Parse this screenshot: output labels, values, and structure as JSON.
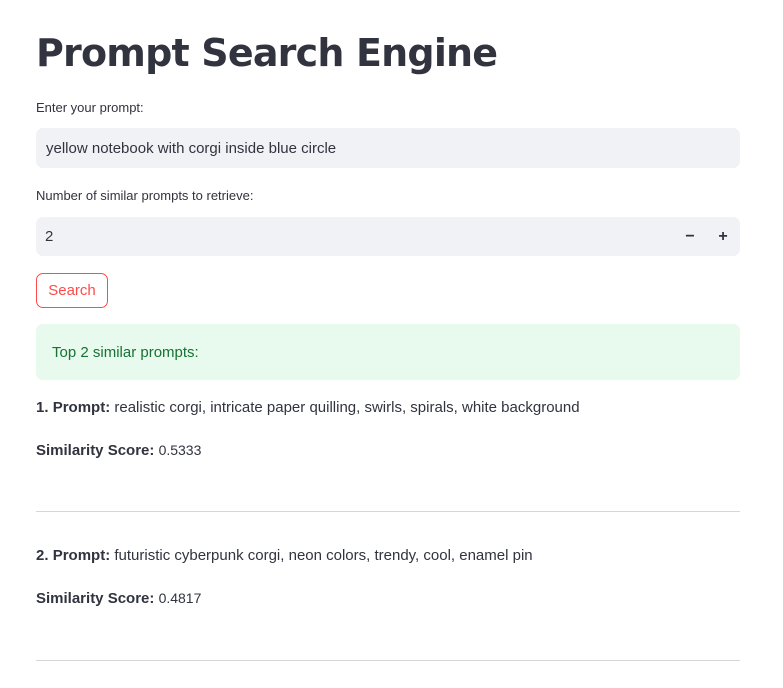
{
  "page": {
    "title": "Prompt Search Engine"
  },
  "prompt_input": {
    "label": "Enter your prompt:",
    "value": "yellow notebook with corgi inside blue circle"
  },
  "count_input": {
    "label": "Number of similar prompts to retrieve:",
    "value": "2",
    "minus_label": "−",
    "plus_label": "+"
  },
  "search_button": {
    "label": "Search"
  },
  "results": {
    "header": "Top 2 similar prompts:",
    "prompt_label": "Prompt:",
    "score_label": "Similarity Score:",
    "items": [
      {
        "index": "1.",
        "prompt": "realistic corgi, intricate paper quilling, swirls, spirals, white background",
        "score": "0.5333"
      },
      {
        "index": "2.",
        "prompt": "futuristic cyberpunk corgi, neon colors, trendy, cool, enamel pin",
        "score": "0.4817"
      }
    ]
  },
  "colors": {
    "accent": "#ff4b4b",
    "success_bg": "#e8f9ee",
    "success_text": "#177233",
    "input_bg": "#f0f2f6",
    "text": "#31333f"
  }
}
